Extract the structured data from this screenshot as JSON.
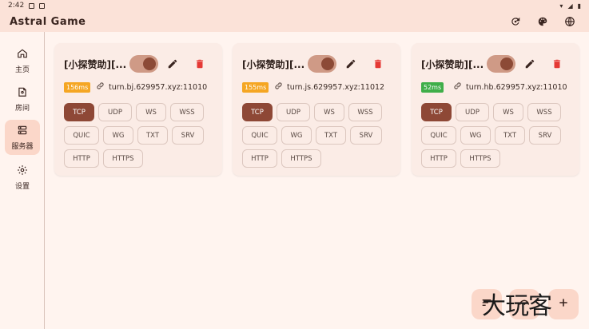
{
  "status_bar": {
    "time": "2:42"
  },
  "app": {
    "title": "Astral Game"
  },
  "rail": {
    "items": [
      {
        "label": "主页",
        "icon": "home-icon"
      },
      {
        "label": "房间",
        "icon": "room-icon"
      },
      {
        "label": "服务器",
        "icon": "server-icon",
        "active": true
      },
      {
        "label": "设置",
        "icon": "gear-icon"
      }
    ]
  },
  "servers": [
    {
      "name": "[小探赞助][...",
      "latency": "156ms",
      "latency_color": "#f5a623",
      "address": "turn.bj.629957.xyz:11010",
      "enabled": true,
      "protocols": [
        "TCP",
        "UDP",
        "WS",
        "WSS",
        "QUIC",
        "WG",
        "TXT",
        "SRV",
        "HTTP",
        "HTTPS"
      ],
      "selected_protocol": "TCP"
    },
    {
      "name": "[小探赞助][...",
      "latency": "155ms",
      "latency_color": "#f5a623",
      "address": "turn.js.629957.xyz:11012",
      "enabled": true,
      "protocols": [
        "TCP",
        "UDP",
        "WS",
        "WSS",
        "QUIC",
        "WG",
        "TXT",
        "SRV",
        "HTTP",
        "HTTPS"
      ],
      "selected_protocol": "TCP"
    },
    {
      "name": "[小探赞助][...",
      "latency": "52ms",
      "latency_color": "#3fae49",
      "address": "turn.hb.629957.xyz:11010",
      "enabled": true,
      "protocols": [
        "TCP",
        "UDP",
        "WS",
        "WSS",
        "QUIC",
        "WG",
        "TXT",
        "SRV",
        "HTTP",
        "HTTPS"
      ],
      "selected_protocol": "TCP"
    }
  ],
  "watermark": "大玩客",
  "colors": {
    "accent": "#8e4836",
    "surface": "#fbece6",
    "background": "#fff4ef"
  }
}
